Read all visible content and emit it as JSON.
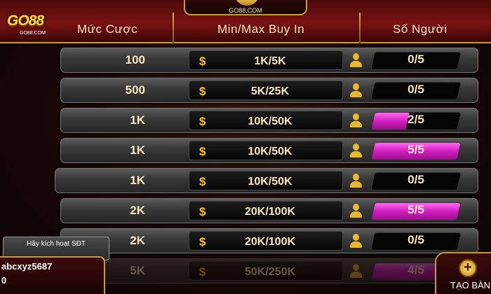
{
  "brand": {
    "logo_text": "GO88",
    "logo_sub": "GO88.COM",
    "top_logo_sub": "GO88.COM"
  },
  "header": {
    "col_bet": "Mức Cược",
    "col_buyin": "Min/Max Buy In",
    "col_players": "Số Người"
  },
  "currency_icon": "$",
  "rows": [
    {
      "bet": "100",
      "buyin": "1K/5K",
      "players": "0/5",
      "fill": 0.0
    },
    {
      "bet": "500",
      "buyin": "5K/25K",
      "players": "0/5",
      "fill": 0.0
    },
    {
      "bet": "1K",
      "buyin": "10K/50K",
      "players": "2/5",
      "fill": 0.4
    },
    {
      "bet": "1K",
      "buyin": "10K/50K",
      "players": "5/5",
      "fill": 1.0
    },
    {
      "bet": "1K",
      "buyin": "10K/50K",
      "players": "0/5",
      "fill": 0.0
    },
    {
      "bet": "2K",
      "buyin": "20K/100K",
      "players": "5/5",
      "fill": 1.0
    },
    {
      "bet": "2K",
      "buyin": "20K/100K",
      "players": "0/5",
      "fill": 0.0
    },
    {
      "bet": "5K",
      "buyin": "50K/250K",
      "players": "4/5",
      "fill": 0.8
    }
  ],
  "account": {
    "activate_label": "Hãy kích hoạt SĐT",
    "username": "abcxyz5687",
    "balance": "0"
  },
  "create_table": {
    "icon": "+",
    "label": "TẠO BÀN"
  },
  "colors": {
    "accent_gold": "#c79a3c",
    "fill_magenta": "#d21fc0",
    "coin": "#ffc21a"
  }
}
